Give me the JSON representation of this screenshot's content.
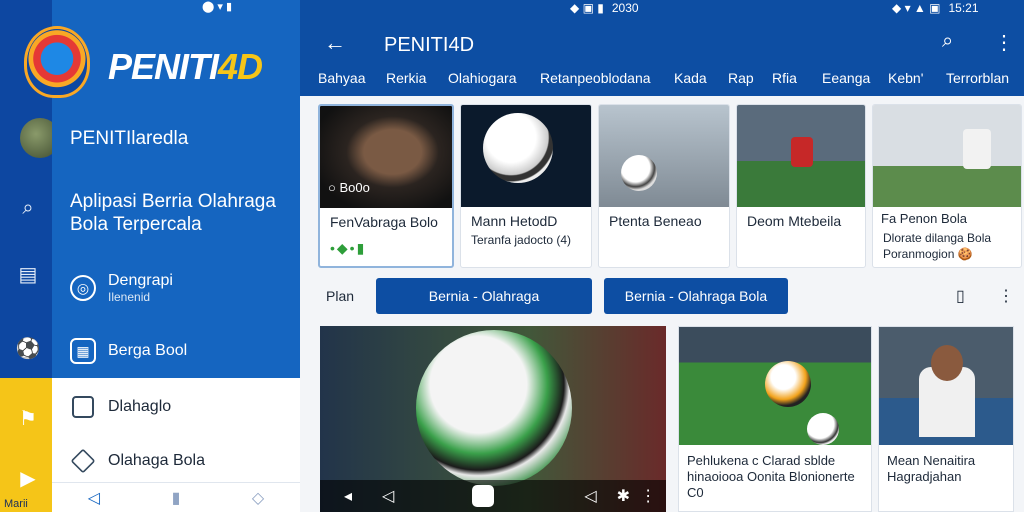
{
  "status": {
    "drawer_icons": "⬤ ▾ ▮",
    "mid_icons": "◆ ▣ ▮",
    "mid_time": "2030",
    "right_icons": "◆ ▾ ▲ ▣",
    "right_time": "15:21"
  },
  "drawer": {
    "brand_main": "PENITI",
    "brand_accent": "4D",
    "title": "PENITIlaredla",
    "subtitle": "Aplipasi Berria Olahraga Bola Terpercala",
    "menu": [
      {
        "label": "Dengrapi",
        "sub": "Ilenenid"
      },
      {
        "label": "Berga Bool"
      }
    ],
    "white_menu": [
      {
        "label": "Dlahaglo"
      },
      {
        "label": "Olahaga Bola"
      }
    ],
    "rail_label": "Marii"
  },
  "appbar": {
    "title": "PENITI4D",
    "tabs": [
      "Bahyaa",
      "Rerkia",
      "Olahiogara",
      "Retanpeoblodana",
      "Kada",
      "Rap",
      "Rfia",
      "Eeanga",
      "Kebn'",
      "Terrorblan"
    ]
  },
  "cards": [
    {
      "overlay": "Bo0o",
      "caption": "FenVabraga Bolo",
      "sub": "•◆•▮"
    },
    {
      "caption": "Mann HetodD",
      "sub": "Teranfa jadocto (4)"
    },
    {
      "caption": "Ptenta Beneao"
    },
    {
      "caption": "Deom Mtebeila"
    },
    {
      "overlay": "Fa Penon Bola",
      "caption": "Dlorate dilanga Bola",
      "sub": "Poranmogion 🍪"
    }
  ],
  "filters": {
    "label": "Plan",
    "pill1": "Bernia - Olahraga",
    "pill2": "Bernia - Olahraga Bola"
  },
  "bottom": {
    "card2": "Pehlukena c Clarad sblde hinaoiooa Oonita Blonionerte C0",
    "card3": "Mean Nenaitira Hagradjahan"
  },
  "colors": {
    "primary": "#0d4ea3",
    "drawer": "#1565c0",
    "accent": "#f5c518"
  }
}
